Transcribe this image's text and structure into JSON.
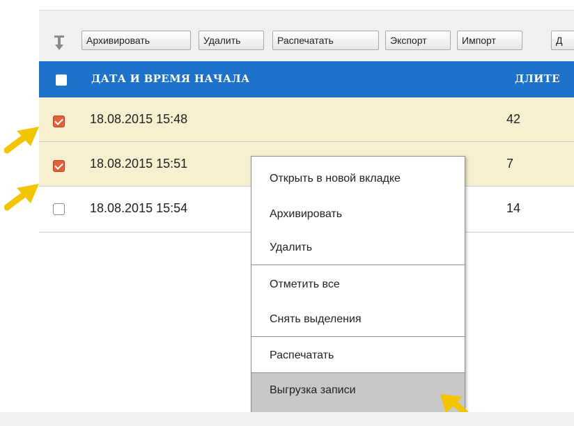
{
  "toolbar": {
    "sort_icon": "down-arrow-icon",
    "buttons": [
      "Архивировать",
      "Удалить",
      "Распечатать",
      "Экспорт",
      "Импорт",
      "Д"
    ]
  },
  "table": {
    "columns": [
      "ДАТА И ВРЕМЯ НАЧАЛА",
      "ДЛИТЕ"
    ],
    "rows": [
      {
        "checked": true,
        "start": "18.08.2015 15:48",
        "duration": "42"
      },
      {
        "checked": true,
        "start": "18.08.2015 15:51",
        "duration": "7"
      },
      {
        "checked": false,
        "start": "18.08.2015 15:54",
        "duration": "14"
      }
    ]
  },
  "context_menu": {
    "items": [
      "Открыть в новой вкладке",
      "Архивировать",
      "Удалить",
      "Отметить все",
      "Снять выделения",
      "Распечатать",
      "Выгрузка записи"
    ],
    "highlighted": "Выгрузка записи"
  },
  "colors": {
    "header": "#1e72c9",
    "selected_row": "#f6efd0",
    "checkbox_checked": "#e2623c",
    "annotation_arrow": "#f2c500",
    "menu_highlight": "#c8c8c8"
  },
  "annotations": {
    "arrow_icon": "yellow-pointer-arrow-icon"
  }
}
